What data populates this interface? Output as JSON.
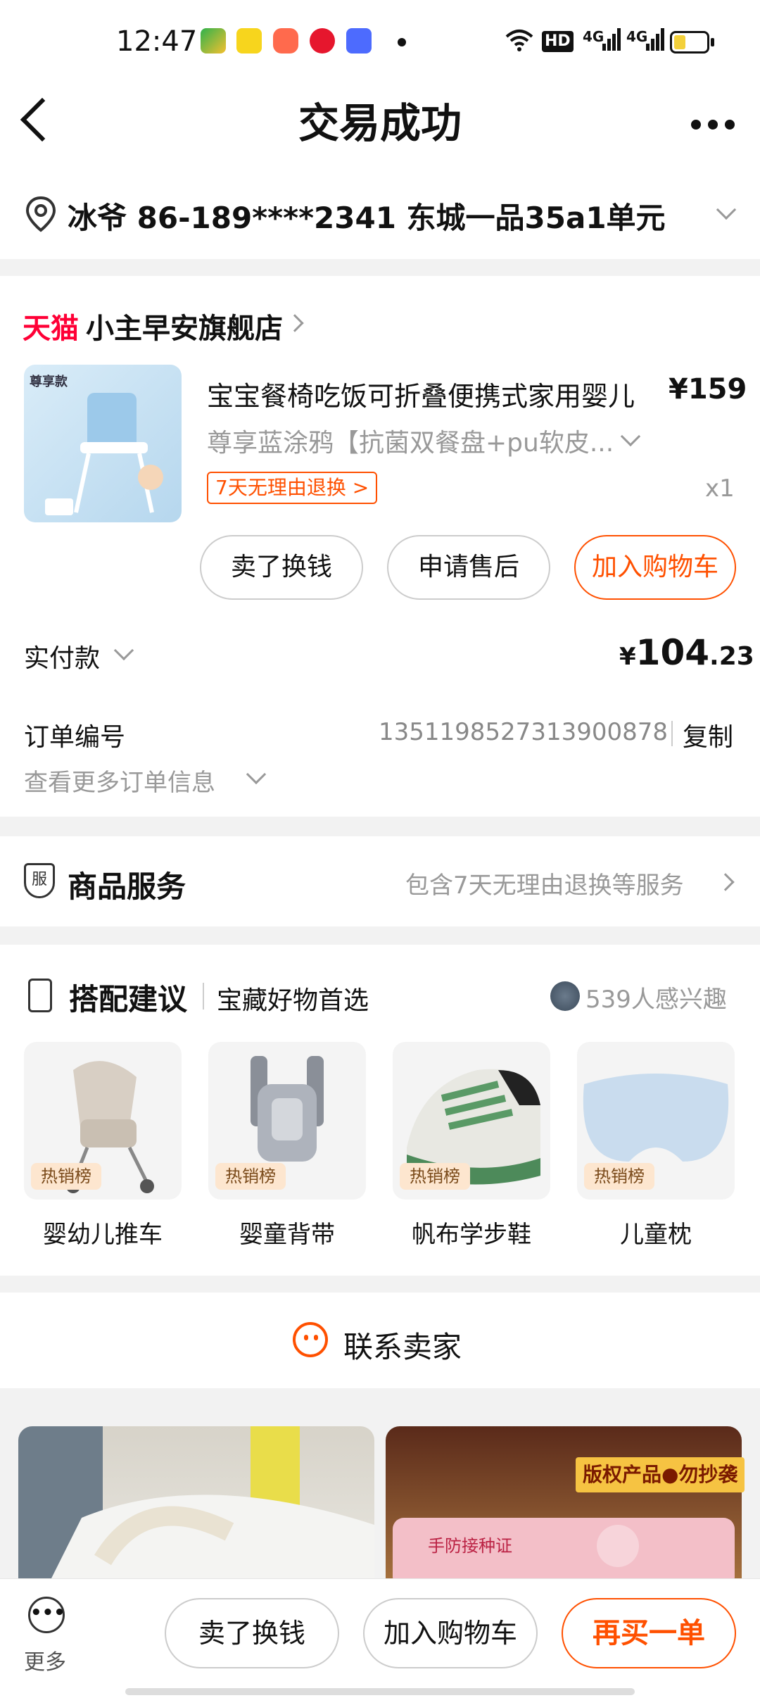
{
  "status_bar": {
    "time": "12:47",
    "network_hd": "HD",
    "net_4g_1": "4G",
    "net_4g_2": "4G"
  },
  "nav": {
    "title": "交易成功"
  },
  "address": {
    "text": "冰爷  86-189****2341  东城一品35a1单元"
  },
  "shop": {
    "brand": "天猫",
    "name": "小主早安旗舰店"
  },
  "product": {
    "title": "宝宝餐椅吃饭可折叠便携式家用婴儿",
    "price": "¥159",
    "sku": "尊享蓝涂鸦【抗菌双餐盘+pu软皮...",
    "tag": "7天无理由退换 >",
    "qty": "x1",
    "img_label": "尊享款"
  },
  "actions": {
    "sell": "卖了换钱",
    "after_sale": "申请售后",
    "add_cart": "加入购物车"
  },
  "payment": {
    "label": "实付款",
    "symbol": "¥",
    "int": "104",
    "dec": ".23"
  },
  "order": {
    "label": "订单编号",
    "number": "1351198527313900878",
    "copy": "复制",
    "more": "查看更多订单信息"
  },
  "service": {
    "title": "商品服务",
    "desc": "包含7天无理由退换等服务",
    "icon_text": "服"
  },
  "suggestions": {
    "title": "搭配建议",
    "subtitle": "宝藏好物首选",
    "interest": "539人感兴趣",
    "hot_label": "热销榜",
    "items": [
      {
        "name": "婴幼儿推车"
      },
      {
        "name": "婴童背带"
      },
      {
        "name": "帆布学步鞋"
      },
      {
        "name": "儿童枕"
      }
    ]
  },
  "contact": {
    "label": "联系卖家"
  },
  "feed": {
    "banner_tag": "版权产品●勿抄袭",
    "card_text": "手防接种证"
  },
  "bottom_bar": {
    "more": "更多",
    "sell": "卖了换钱",
    "add_cart": "加入购物车",
    "rebuy": "再买一单",
    "more_icon": "•••"
  },
  "colors": {
    "accent": "#ff5000",
    "tmall": "#ff0036"
  }
}
